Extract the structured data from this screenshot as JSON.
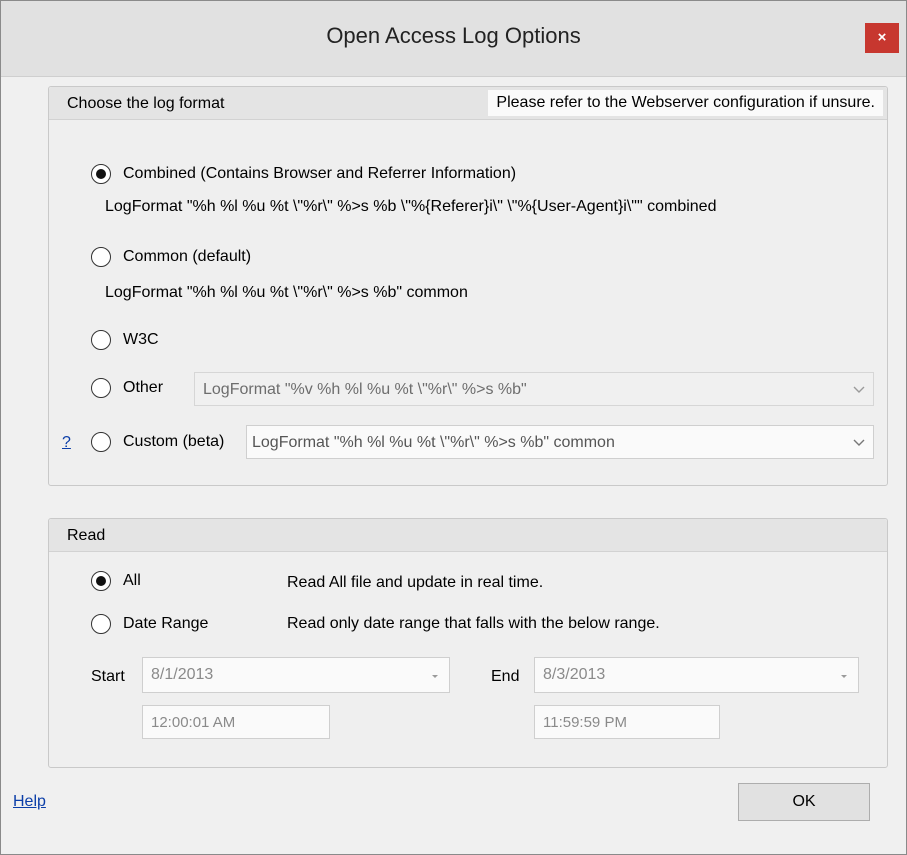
{
  "window": {
    "title": "Open Access Log Options",
    "close_label": "×"
  },
  "log_format": {
    "title": "Choose the log format",
    "hint": "Please refer to the Webserver configuration if unsure.",
    "options": [
      {
        "label": "Combined (Contains Browser and Referrer Information)",
        "selected": true,
        "detail": "LogFormat \"%h %l %u %t \\\"%r\\\" %>s %b \\\"%{Referer}i\\\" \\\"%{User-Agent}i\\\"\" combined"
      },
      {
        "label": "Common (default)",
        "selected": false,
        "detail": "LogFormat \"%h %l %u %t \\\"%r\\\" %>s %b\" common"
      },
      {
        "label": "W3C",
        "selected": false
      },
      {
        "label": "Other",
        "selected": false,
        "combo_value": "LogFormat \"%v %h %l %u %t \\\"%r\\\" %>s %b\""
      },
      {
        "label": "Custom (beta)",
        "selected": false,
        "combo_value": "LogFormat \"%h %l %u %t \\\"%r\\\" %>s %b\" common",
        "help_link": "?"
      }
    ]
  },
  "read": {
    "title": "Read",
    "options": [
      {
        "label": "All",
        "description": "Read All file and update in real time.",
        "selected": true
      },
      {
        "label": "Date Range",
        "description": "Read only date range that falls with the below range.",
        "selected": false
      }
    ],
    "start": {
      "label": "Start",
      "date": "8/1/2013",
      "time": "12:00:01 AM"
    },
    "end": {
      "label": "End",
      "date": "8/3/2013",
      "time": "11:59:59 PM"
    }
  },
  "footer": {
    "help_label": "Help",
    "ok_label": "OK"
  },
  "icons": {
    "close": "close-icon",
    "dropdown": "chevron-down-icon"
  },
  "colors": {
    "close_button": "#c7372f",
    "link": "#0b3ea8"
  }
}
